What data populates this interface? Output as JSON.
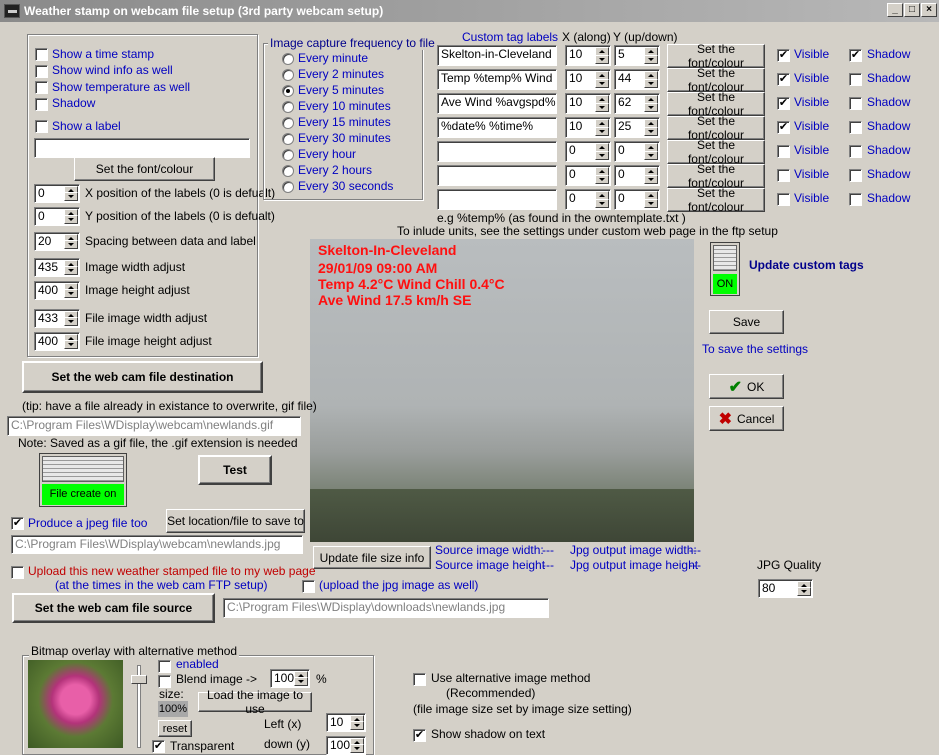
{
  "window": {
    "title": "Weather stamp on webcam file setup (3rd party webcam setup)"
  },
  "options": {
    "time_stamp": "Show a time stamp",
    "wind_info": "Show wind info as well",
    "temperature": "Show temperature as well",
    "shadow": "Shadow",
    "show_label": "Show a label",
    "set_font": "Set the font/colour"
  },
  "adjust": [
    {
      "value": "0",
      "label": "X position of the labels (0 is defualt)"
    },
    {
      "value": "0",
      "label": "Y position of the labels (0 is defualt)"
    },
    {
      "value": "20",
      "label": "Spacing between data and label"
    },
    {
      "value": "435",
      "label": "Image width adjust"
    },
    {
      "value": "400",
      "label": "Image height adjust"
    },
    {
      "value": "433",
      "label": "File image width adjust"
    },
    {
      "value": "400",
      "label": "File image height adjust"
    }
  ],
  "capture": {
    "title": "Image capture frequency to file",
    "options": [
      "Every minute",
      "Every 2 minutes",
      "Every 5 minutes",
      "Every 10 minutes",
      "Every 15 minutes",
      "Every 30 minutes",
      "Every hour",
      "Every 2 hours",
      "Every 30 seconds"
    ],
    "selected": "Every 5 minutes"
  },
  "custom": {
    "header_label": "Custom tag labels",
    "header_x": "X (along)",
    "header_y": "Y (up/down)",
    "font_button": "Set the font/colour",
    "visible": "Visible",
    "shadow": "Shadow",
    "rows": [
      {
        "label": "Skelton-in-Cleveland",
        "x": "10",
        "y": "5",
        "visible": true,
        "shadow": true
      },
      {
        "label": "Temp %temp% Wind Chi",
        "x": "10",
        "y": "44",
        "visible": true,
        "shadow": false
      },
      {
        "label": "Ave Wind %avgspd% %",
        "x": "10",
        "y": "62",
        "visible": true,
        "shadow": false
      },
      {
        "label": "%date%   %time%",
        "x": "10",
        "y": "25",
        "visible": true,
        "shadow": false
      },
      {
        "label": "",
        "x": "0",
        "y": "0",
        "visible": false,
        "shadow": false
      },
      {
        "label": "",
        "x": "0",
        "y": "0",
        "visible": false,
        "shadow": false
      },
      {
        "label": "",
        "x": "0",
        "y": "0",
        "visible": false,
        "shadow": false
      }
    ],
    "hint1": "e.g %temp% (as found in the owntemplate.txt )",
    "hint2": "To inlude units, see the settings under custom web page in the ftp setup"
  },
  "webcam": {
    "line1": "Skelton-In-Cleveland",
    "line2": "29/01/09   09:00 AM",
    "line3": "Temp 4.2°C Wind Chill 0.4°C",
    "line4": "Ave Wind 17.5 km/h SE"
  },
  "update": {
    "label": "Update custom tags",
    "state": "ON"
  },
  "save": {
    "button": "Save",
    "hint": "To save the settings"
  },
  "ok": "OK",
  "cancel": "Cancel",
  "destination": {
    "button": "Set the web cam file destination",
    "tip": "(tip: have a file already in existance to overwrite, gif file)",
    "path": "C:\\Program Files\\WDisplay\\webcam\\newlands.gif",
    "note": "Note: Saved as a gif file, the .gif extension is needed",
    "file_create": "File create on",
    "test": "Test"
  },
  "jpeg": {
    "checkbox": "Produce a jpeg file too",
    "set_location": "Set location/file to save to",
    "path": "C:\\Program Files\\WDisplay\\webcam\\newlands.jpg",
    "update_size": "Update file size info",
    "source_w": "Source image width:",
    "source_h": "Source image height",
    "src_w_val": "---",
    "src_h_val": "---",
    "jpg_w": "Jpg output image width:",
    "jpg_h": "Jpg output image height",
    "jpg_w_val": "---",
    "jpg_h_val": "---",
    "quality_label": "JPG Quality",
    "quality": "80"
  },
  "upload": {
    "line1": "Upload this new weather stamped file to my web page",
    "line2": "(at the times in the web cam FTP setup)",
    "jpg": "(upload the jpg image as well)"
  },
  "source": {
    "button": "Set the web cam file source",
    "path": "C:\\Program Files\\WDisplay\\downloads\\newlands.jpg"
  },
  "bitmap": {
    "title": "Bitmap overlay with alternative method",
    "enabled": "enabled",
    "blend": "Blend image ->",
    "blend_value": "100",
    "percent": "%",
    "size": "size:",
    "size_value": "100%",
    "load": "Load the image to use",
    "reset": "reset",
    "left": "Left (x)",
    "left_value": "10",
    "down": "down (y)",
    "down_value": "100",
    "transparent": "Transparent"
  },
  "alt": {
    "use": "Use alternative image method",
    "recommended": "(Recommended)",
    "note": "(file image size set by image size setting)",
    "shadow_text": "Show shadow on text"
  }
}
